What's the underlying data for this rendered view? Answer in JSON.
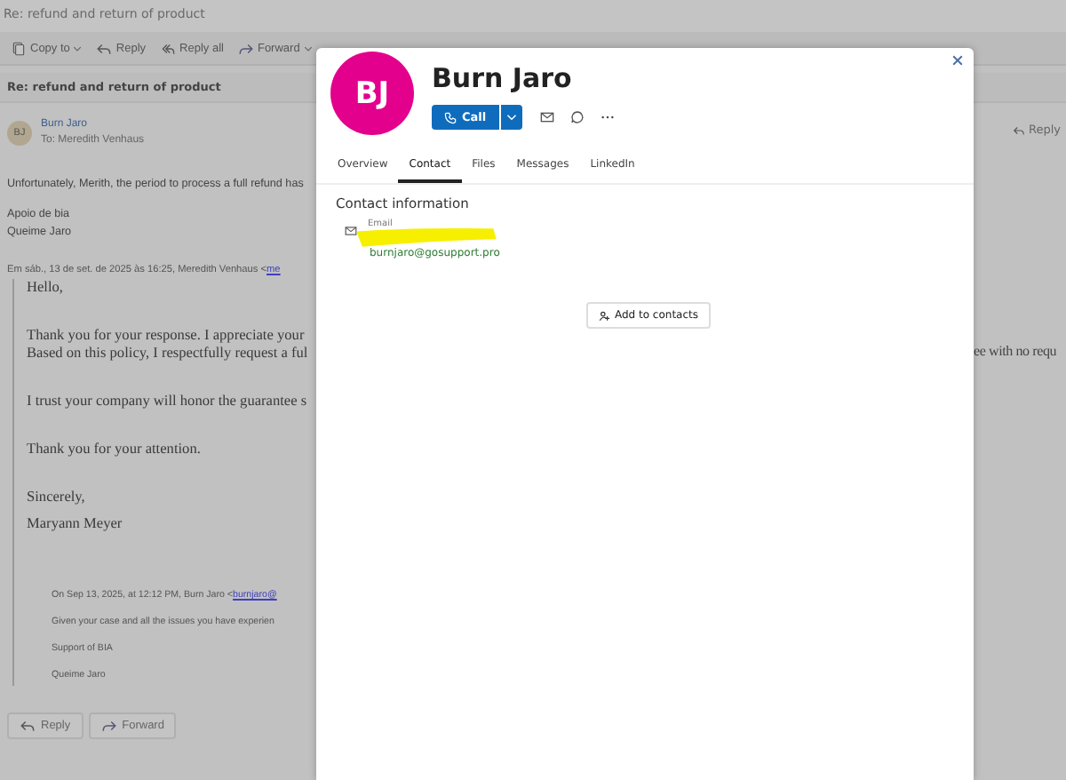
{
  "window": {
    "title": "Re: refund and return of product"
  },
  "toolbar": [
    {
      "label": "Copy to",
      "dropdown": true
    },
    {
      "label": "Reply",
      "dropdown": false
    },
    {
      "label": "Reply all",
      "dropdown": false
    },
    {
      "label": "Forward",
      "dropdown": true
    }
  ],
  "message": {
    "subject": "Re: refund and return of product",
    "sender": {
      "initials": "BJ",
      "name": "Burn Jaro",
      "to": "To: Meredith Venhaus"
    },
    "reply_label": "Reply",
    "body": [
      "Unfortunately, Merith, the period to process a full refund has",
      "Apoio de bia\nQueime Jaro"
    ],
    "quote_header": {
      "text": "Em sáb., 13 de set. de 2025 às 16:25, Meredith Venhaus <",
      "link": "me"
    },
    "quoted": [
      "Hello,",
      "Thank you for your response. I appreciate your\nBased on this policy, I respectfully request a ful",
      "I trust your company will honor the guarantee s",
      "Thank you for your attention.",
      "Sincerely,",
      "Maryann Meyer"
    ],
    "quoted_fragment": "ee with no requ",
    "nested": {
      "header": "On Sep 13, 2025, at 12:12 PM, Burn Jaro <",
      "link": "burnjaro@",
      "lines": [
        "Given your case and all the issues you have experien",
        "Support of BIA",
        "Queime Jaro"
      ]
    },
    "actions": [
      {
        "label": "Reply"
      },
      {
        "label": "Forward"
      }
    ]
  },
  "contact_card": {
    "initials": "BJ",
    "name": "Burn Jaro",
    "call_label": "Call",
    "tabs": [
      {
        "label": "Overview",
        "selected": false
      },
      {
        "label": "Contact",
        "selected": true
      },
      {
        "label": "Files",
        "selected": false
      },
      {
        "label": "Messages",
        "selected": false
      },
      {
        "label": "LinkedIn",
        "selected": false
      }
    ],
    "section_title": "Contact information",
    "email": {
      "label": "Email",
      "value": "burnjaro@gosupport.pro",
      "highlighted": true
    },
    "add_button": "Add to contacts"
  }
}
